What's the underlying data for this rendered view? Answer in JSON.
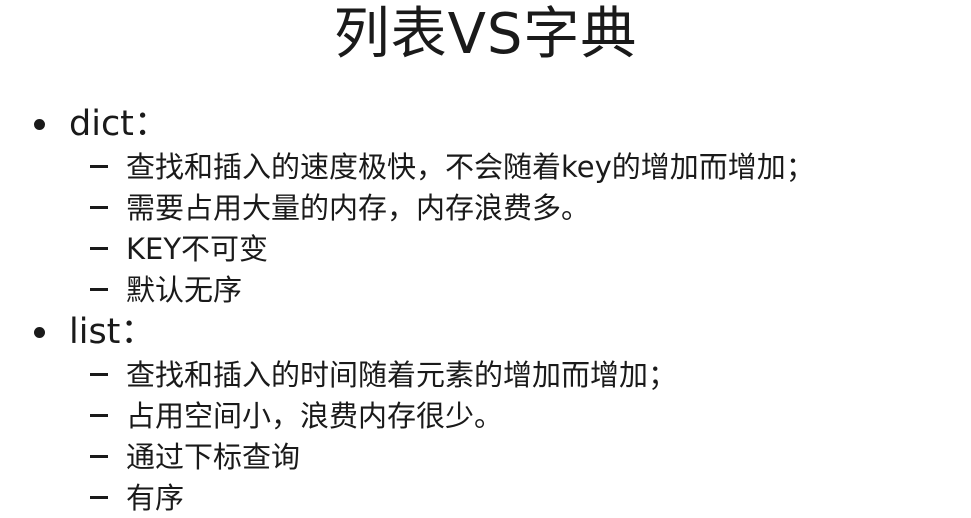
{
  "slide": {
    "title": "列表VS字典",
    "sections": [
      {
        "heading": "dict：",
        "items": [
          "查找和插入的速度极快，不会随着key的增加而增加；",
          "需要占用大量的内存，内存浪费多。",
          "KEY不可变",
          "默认无序"
        ]
      },
      {
        "heading": "list：",
        "items": [
          "查找和插入的时间随着元素的增加而增加；",
          "占用空间小，浪费内存很少。",
          "通过下标查询",
          "有序"
        ]
      }
    ]
  }
}
